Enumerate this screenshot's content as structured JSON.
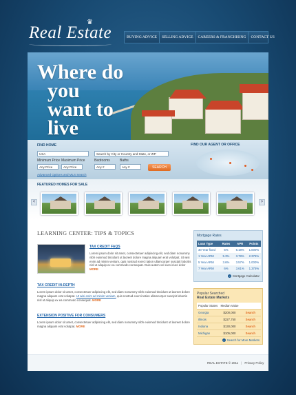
{
  "brand": {
    "logo": "Real Estate"
  },
  "nav": [
    "BUYING ADVICE",
    "SELLING ADVICE",
    "CAREERS & FRANCHISING",
    "CONTACT US"
  ],
  "hero": {
    "line1": "Where do",
    "line2": "you",
    "line3": "want to",
    "line4": "live"
  },
  "search": {
    "title": "FIND HOME",
    "country": "USA",
    "city_placeholder": "Search by City or Country and State, or ZIP",
    "min_price_label": "Minimum Price",
    "max_price_label": "Maximum Price",
    "bedrooms_label": "Bedrooms",
    "baths_label": "Baths",
    "min_price_value": "Any Price",
    "max_price_value": "Any Price",
    "bedrooms_value": "Any #",
    "baths_value": "Any #",
    "button": "SEARCH",
    "advanced_link": "Advanced Options and MLS Search",
    "agent_title": "FIND OUR AGENT OR OFFICE"
  },
  "featured": {
    "title": "FEATURED HOMES FOR SALE",
    "prev": "<",
    "next": ">"
  },
  "learning": {
    "title": "LEARNING CENTER: TIPS & TOPICS",
    "item1": {
      "title": "TAX CREDIT FAQS",
      "text": "Lorem ipsum dolor sit amet, consectetuer adipiscing elit, sed diam nonummy nibh euismod tincidunt ut laoreet dolore magna aliquam erat volutpat. Ut wisi enim ad minim veniam, quis nostrud exerci tation ullamcorper suscipit lobortis nisl ut aliquip ex ea commodo consequat. Duis autem vel eum iriure dolor",
      "more": "MORE"
    },
    "item2": {
      "title": "TAX CREDIT IN-DEPTH",
      "text_a": "Lorem ipsum dolor sit amet, consectetuer adipiscing elit, sed diam nonummy nibh euismod tincidunt ut laoreet dolore magna aliquam erat volutpat.",
      "link": "Ut wisi enim ad minim veniam,",
      "text_b": "quis nostrud exerci tation ullamcorper suscipit lobortis nisl ut aliquip ex ea commodo consequat.",
      "more": "MORE"
    },
    "item3": {
      "title": "EXTENSION POSITIVE FOR CONSUMERS",
      "text": "Lorem ipsum dolor sit amet, consectetuer adipiscing elit, sed diam nonummy nibh euismod tincidunt ut laoreet dolore magna aliquam erat volutpat.",
      "more": "MORE"
    }
  },
  "mortgage": {
    "title": "Mortgage Rates",
    "headers": [
      "Loan Type",
      "Rates",
      "APR",
      "Points"
    ],
    "rows": [
      [
        "30 Year fixed",
        "5%",
        "6.18%",
        "1.000%"
      ],
      [
        "1 Year ARM",
        "5.3%",
        "3.78%",
        "2.375%"
      ],
      [
        "5 Year ARM",
        "3.6%",
        "3.57%",
        "1.000%"
      ],
      [
        "7 Year ARM",
        "6%",
        "3.61%",
        "1.375%"
      ]
    ],
    "calc_link": "Mortgage Calculator"
  },
  "popular": {
    "title_line1": "Popular Searched",
    "title_line2": "Real Estate Markets",
    "headers": [
      "Popular States",
      "Median Value",
      ""
    ],
    "rows": [
      [
        "Georgia",
        "$200,000",
        "Search"
      ],
      [
        "Illinois",
        "$227,750",
        "Search"
      ],
      [
        "Indiana",
        "$130,000",
        "Search"
      ],
      [
        "Michigan",
        "$105,000",
        "Search"
      ]
    ],
    "more_link": "Search for More Markets"
  },
  "footer": {
    "copyright": "REAL ESTATE  © 2011",
    "sep": "|",
    "privacy": "Privacy Policy"
  }
}
